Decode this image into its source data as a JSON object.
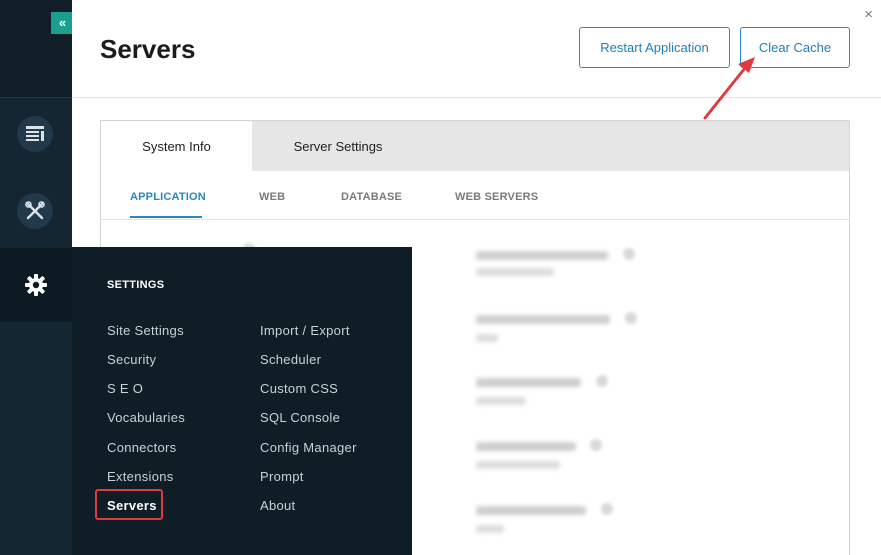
{
  "rail": {
    "collapse_label": "«",
    "icons": [
      "content-icon",
      "tools-icon",
      "gear-icon"
    ]
  },
  "header": {
    "title": "Servers",
    "restart_label": "Restart Application",
    "clear_cache_label": "Clear Cache",
    "close_label": "×"
  },
  "tabs": [
    "System Info",
    "Server Settings"
  ],
  "subtabs": [
    "APPLICATION",
    "WEB",
    "DATABASE",
    "WEB SERVERS"
  ],
  "settings_menu": {
    "title": "SETTINGS",
    "col1": [
      "Site Settings",
      "Security",
      "S E O",
      "Vocabularies",
      "Connectors",
      "Extensions",
      "Servers"
    ],
    "col2": [
      "Import / Export",
      "Scheduler",
      "Custom CSS",
      "SQL Console",
      "Config Manager",
      "Prompt",
      "About"
    ]
  },
  "colors": {
    "accent": "#2a86c0",
    "rail": "#132631",
    "flyout": "#0f1e26",
    "highlight": "#e03a3e",
    "collapse": "#1a9f8f"
  }
}
